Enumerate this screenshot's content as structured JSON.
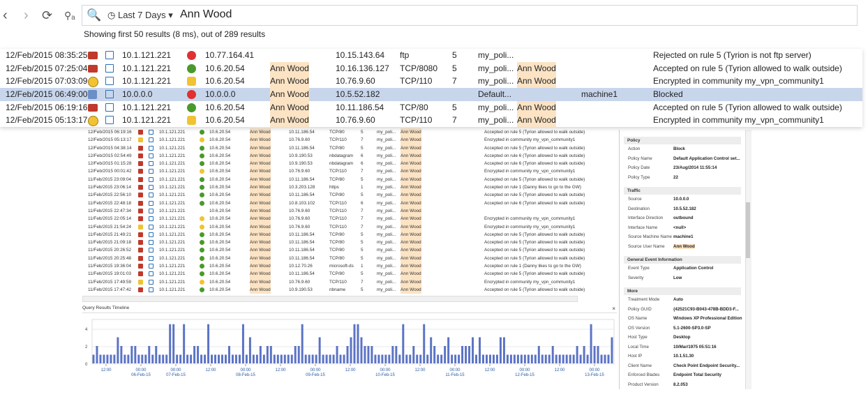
{
  "toolbar": {
    "back_icon": "‹",
    "forward_icon": "›",
    "refresh_icon": "⟳",
    "query_icon": "⚲ₐ",
    "search_icon": "🔍",
    "time_icon": "◷",
    "time_range": "Last 7 Days ▾",
    "query": "Ann Wood"
  },
  "summary": "Showing first 50 results (8 ms), out of 289 results",
  "big_rows": [
    {
      "time": "12/Feb/2015 08:35:25",
      "blade": "fw",
      "src": "10.1.121.221",
      "action": "block",
      "dst_ip": "10.77.164.41",
      "user": "",
      "dst": "10.15.143.64",
      "service": "ftp",
      "n": "5",
      "rule": "my_poli...",
      "user2": "",
      "machine": "",
      "desc": "Rejected on rule 5 (Tyrion is not ftp server)",
      "sel": false
    },
    {
      "time": "12/Feb/2015 07:25:04",
      "blade": "fw",
      "src": "10.1.121.221",
      "action": "accept",
      "dst_ip": "10.6.20.54",
      "user": "Ann Wood",
      "dst": "10.16.136.127",
      "service": "TCP/8080",
      "n": "5",
      "rule": "my_poli...",
      "user2": "Ann Wood",
      "machine": "",
      "desc": "Accepted on rule 5 (Tyrion allowed to walk outside)",
      "sel": false
    },
    {
      "time": "12/Feb/2015 07:03:09",
      "blade": "vpn",
      "src": "10.1.121.221",
      "action": "lock",
      "dst_ip": "10.6.20.54",
      "user": "Ann Wood",
      "dst": "10.76.9.60",
      "service": "TCP/110",
      "n": "7",
      "rule": "my_poli...",
      "user2": "Ann Wood",
      "machine": "",
      "desc": "Encrypted in community my_vpn_community1",
      "sel": false
    },
    {
      "time": "12/Feb/2015 06:49:00",
      "blade": "app",
      "src": "10.0.0.0",
      "action": "block",
      "dst_ip": "10.0.0.0",
      "user": "Ann Wood",
      "dst": "10.5.52.182",
      "service": "",
      "n": "",
      "rule": "Default...",
      "user2": "",
      "machine": "machine1",
      "desc": "Blocked",
      "sel": true
    },
    {
      "time": "12/Feb/2015 06:19:16",
      "blade": "fw",
      "src": "10.1.121.221",
      "action": "accept",
      "dst_ip": "10.6.20.54",
      "user": "Ann Wood",
      "dst": "10.11.186.54",
      "service": "TCP/80",
      "n": "5",
      "rule": "my_poli...",
      "user2": "Ann Wood",
      "machine": "",
      "desc": "Accepted on rule 5 (Tyrion allowed to walk outside)",
      "sel": false
    },
    {
      "time": "12/Feb/2015 05:13:17",
      "blade": "vpn",
      "src": "10.1.121.221",
      "action": "lock",
      "dst_ip": "10.6.20.54",
      "user": "Ann Wood",
      "dst": "10.76.9.60",
      "service": "TCP/110",
      "n": "7",
      "rule": "my_poli...",
      "user2": "Ann Wood",
      "machine": "",
      "desc": "Encrypted in community my_vpn_community1",
      "sel": false
    }
  ],
  "small_rows": [
    {
      "time": "12/Feb/2015 06:19:16",
      "blade": "fw",
      "src": "10.1.121.221",
      "action": "accept",
      "dst_ip": "10.6.20.54",
      "user": "Ann Wood",
      "dst": "10.11.186.54",
      "service": "TCP/80",
      "n": "5",
      "rule": "my_poli...",
      "user2": "Ann Wood",
      "desc": "Accepted on rule 5 (Tyrion allowed to walk outside)"
    },
    {
      "time": "12/Feb/2015 05:13:17",
      "blade": "vpn",
      "src": "10.1.121.221",
      "action": "lock",
      "dst_ip": "10.6.20.54",
      "user": "Ann Wood",
      "dst": "10.76.9.60",
      "service": "TCP/110",
      "n": "7",
      "rule": "my_poli...",
      "user2": "Ann Wood",
      "desc": "Encrypted in community my_vpn_community1"
    },
    {
      "time": "12/Feb/2015 04:38:14",
      "blade": "fw",
      "src": "10.1.121.221",
      "action": "accept",
      "dst_ip": "10.6.20.54",
      "user": "Ann Wood",
      "dst": "10.11.186.54",
      "service": "TCP/80",
      "n": "5",
      "rule": "my_poli...",
      "user2": "Ann Wood",
      "desc": "Accepted on rule 5 (Tyrion allowed to walk outside)"
    },
    {
      "time": "12/Feb/2015 02:54:49",
      "blade": "fw",
      "src": "10.1.121.221",
      "action": "accept",
      "dst_ip": "10.6.20.54",
      "user": "Ann Wood",
      "dst": "10.9.190.53",
      "service": "nbdatagram",
      "n": "6",
      "rule": "my_poli...",
      "user2": "Ann Wood",
      "desc": "Accepted on rule 6 (Tyrion allowed to walk outside)"
    },
    {
      "time": "12/Feb/2015 01:15:28",
      "blade": "fw",
      "src": "10.1.121.221",
      "action": "accept",
      "dst_ip": "10.6.20.54",
      "user": "Ann Wood",
      "dst": "10.9.190.53",
      "service": "nbdatagram",
      "n": "6",
      "rule": "my_poli...",
      "user2": "Ann Wood",
      "desc": "Accepted on rule 6 (Tyrion allowed to walk outside)"
    },
    {
      "time": "12/Feb/2015 00:01:42",
      "blade": "fw",
      "src": "10.1.121.221",
      "action": "lock",
      "dst_ip": "10.6.20.54",
      "user": "Ann Wood",
      "dst": "10.76.9.60",
      "service": "TCP/110",
      "n": "7",
      "rule": "my_poli...",
      "user2": "Ann Wood",
      "desc": "Encrypted in community my_vpn_community1"
    },
    {
      "time": "11/Feb/2015 23:09:04",
      "blade": "fw",
      "src": "10.1.121.221",
      "action": "accept",
      "dst_ip": "10.6.20.54",
      "user": "Ann Wood",
      "dst": "10.11.186.54",
      "service": "TCP/80",
      "n": "5",
      "rule": "my_poli...",
      "user2": "Ann Wood",
      "desc": "Accepted on rule 5 (Tyrion allowed to walk outside)"
    },
    {
      "time": "11/Feb/2015 23:06:14",
      "blade": "fw",
      "src": "10.1.121.221",
      "action": "accept",
      "dst_ip": "10.6.20.54",
      "user": "Ann Wood",
      "dst": "10.3.203.128",
      "service": "https",
      "n": "1",
      "rule": "my_poli...",
      "user2": "Ann Wood",
      "desc": "Accepted on rule 1 (Danny likes to go to the GW)"
    },
    {
      "time": "11/Feb/2015 22:56:10",
      "blade": "fw",
      "src": "10.1.121.221",
      "action": "accept",
      "dst_ip": "10.6.20.54",
      "user": "Ann Wood",
      "dst": "10.11.186.54",
      "service": "TCP/80",
      "n": "5",
      "rule": "my_poli...",
      "user2": "Ann Wood",
      "desc": "Accepted on rule 5 (Tyrion allowed to walk outside)"
    },
    {
      "time": "11/Feb/2015 22:48:18",
      "blade": "fw",
      "src": "10.1.121.221",
      "action": "accept",
      "dst_ip": "10.6.20.54",
      "user": "Ann Wood",
      "dst": "10.8.103.102",
      "service": "TCP/110",
      "n": "6",
      "rule": "my_poli...",
      "user2": "Ann Wood",
      "desc": "Accepted on rule 6 (Tyrion allowed to walk outside)"
    },
    {
      "time": "11/Feb/2015 22:47:34",
      "blade": "fw",
      "src": "10.1.121.221",
      "action": "",
      "dst_ip": "10.6.20.54",
      "user": "Ann Wood",
      "dst": "10.76.9.60",
      "service": "TCP/110",
      "n": "7",
      "rule": "my_poli...",
      "user2": "Ann Wood",
      "desc": ""
    },
    {
      "time": "11/Feb/2015 22:05:14",
      "blade": "fw",
      "src": "10.1.121.221",
      "action": "lock",
      "dst_ip": "10.6.20.54",
      "user": "Ann Wood",
      "dst": "10.76.9.60",
      "service": "TCP/110",
      "n": "7",
      "rule": "my_poli...",
      "user2": "Ann Wood",
      "desc": "Encrypted in community my_vpn_community1"
    },
    {
      "time": "11/Feb/2015 21:54:24",
      "blade": "vpn",
      "src": "10.1.121.221",
      "action": "lock",
      "dst_ip": "10.6.20.54",
      "user": "Ann Wood",
      "dst": "10.76.9.60",
      "service": "TCP/110",
      "n": "7",
      "rule": "my_poli...",
      "user2": "Ann Wood",
      "desc": "Encrypted in community my_vpn_community1"
    },
    {
      "time": "11/Feb/2015 21:49:21",
      "blade": "fw",
      "src": "10.1.121.221",
      "action": "accept",
      "dst_ip": "10.6.20.54",
      "user": "Ann Wood",
      "dst": "10.11.186.54",
      "service": "TCP/80",
      "n": "5",
      "rule": "my_poli...",
      "user2": "Ann Wood",
      "desc": "Accepted on rule 5 (Tyrion allowed to walk outside)"
    },
    {
      "time": "11/Feb/2015 21:09:18",
      "blade": "fw",
      "src": "10.1.121.221",
      "action": "accept",
      "dst_ip": "10.6.20.54",
      "user": "Ann Wood",
      "dst": "10.11.186.54",
      "service": "TCP/80",
      "n": "5",
      "rule": "my_poli...",
      "user2": "Ann Wood",
      "desc": "Accepted on rule 5 (Tyrion allowed to walk outside)"
    },
    {
      "time": "11/Feb/2015 20:26:52",
      "blade": "fw",
      "src": "10.1.121.221",
      "action": "accept",
      "dst_ip": "10.6.20.54",
      "user": "Ann Wood",
      "dst": "10.11.186.54",
      "service": "TCP/80",
      "n": "5",
      "rule": "my_poli...",
      "user2": "Ann Wood",
      "desc": "Accepted on rule 5 (Tyrion allowed to walk outside)"
    },
    {
      "time": "11/Feb/2015 20:25:48",
      "blade": "fw",
      "src": "10.1.121.221",
      "action": "accept",
      "dst_ip": "10.6.20.54",
      "user": "Ann Wood",
      "dst": "10.11.186.54",
      "service": "TCP/80",
      "n": "5",
      "rule": "my_poli...",
      "user2": "Ann Wood",
      "desc": "Accepted on rule 5 (Tyrion allowed to walk outside)"
    },
    {
      "time": "11/Feb/2015 19:36:04",
      "blade": "fw",
      "src": "10.1.121.221",
      "action": "accept",
      "dst_ip": "10.6.20.54",
      "user": "Ann Wood",
      "dst": "10.12.70.26",
      "service": "microsoft-ds",
      "n": "1",
      "rule": "my_poli...",
      "user2": "Ann Wood",
      "desc": "Accepted on rule 1 (Danny likes to go to the GW)"
    },
    {
      "time": "11/Feb/2015 19:01:03",
      "blade": "fw",
      "src": "10.1.121.221",
      "action": "accept",
      "dst_ip": "10.6.20.54",
      "user": "Ann Wood",
      "dst": "10.11.186.54",
      "service": "TCP/80",
      "n": "5",
      "rule": "my_poli...",
      "user2": "Ann Wood",
      "desc": "Accepted on rule 5 (Tyrion allowed to walk outside)"
    },
    {
      "time": "11/Feb/2015 17:49:59",
      "blade": "vpn",
      "src": "10.1.121.221",
      "action": "lock",
      "dst_ip": "10.6.20.54",
      "user": "Ann Wood",
      "dst": "10.76.9.60",
      "service": "TCP/110",
      "n": "7",
      "rule": "my_poli...",
      "user2": "Ann Wood",
      "desc": "Encrypted in community my_vpn_community1"
    },
    {
      "time": "11/Feb/2015 17:47:42",
      "blade": "fw",
      "src": "10.1.121.221",
      "action": "accept",
      "dst_ip": "10.6.20.54",
      "user": "Ann Wood",
      "dst": "10.9.190.53",
      "service": "nbname",
      "n": "5",
      "rule": "my_poli...",
      "user2": "Ann Wood",
      "desc": "Accepted on rule 5 (Tyrion allowed to walk outside)"
    }
  ],
  "timeline": {
    "title": "Query Results Timeline",
    "close": "×",
    "y_ticks": [
      "4",
      "2",
      "0"
    ],
    "x_labels": [
      [
        "12:00",
        ""
      ],
      [
        "00:00",
        "06-Feb-15"
      ],
      [
        "00:00",
        "07-Feb-15"
      ],
      [
        "12:00",
        ""
      ],
      [
        "00:00",
        "08-Feb-15"
      ],
      [
        "12:00",
        ""
      ],
      [
        "00:00",
        "09-Feb-15"
      ],
      [
        "12:00",
        ""
      ],
      [
        "00:00",
        "10-Feb-15"
      ],
      [
        "12:00",
        ""
      ],
      [
        "00:00",
        "11-Feb-15"
      ],
      [
        "12:00",
        ""
      ],
      [
        "00:00",
        "12-Feb-15"
      ],
      [
        "12:00",
        ""
      ],
      [
        "00:00",
        "13-Feb-15"
      ],
      [
        "12:00",
        ""
      ]
    ],
    "bar_color": "#5b73c4"
  },
  "details": {
    "sections": [
      {
        "title": "Policy",
        "rows": [
          [
            "Action",
            "Block"
          ],
          [
            "Policy Name",
            "Default Application Control set..."
          ],
          [
            "Policy Date",
            "23/Aug/2014 11:55:14"
          ],
          [
            "Policy Type",
            "22"
          ]
        ]
      },
      {
        "title": "Traffic",
        "rows": [
          [
            "Source",
            "10.0.0.0"
          ],
          [
            "Destination",
            "10.5.52.182"
          ],
          [
            "Interface Direction",
            "outbound"
          ],
          [
            "Interface Name",
            "<null>"
          ],
          [
            "Source Machine Name",
            "machine1"
          ],
          [
            "Source User Name",
            "Ann Wood"
          ]
        ]
      },
      {
        "title": "General Event Information",
        "rows": [
          [
            "Event Type",
            "Application Control"
          ],
          [
            "Severity",
            "Low"
          ]
        ]
      },
      {
        "title": "More",
        "rows": [
          [
            "Treatment Mode",
            "Auto"
          ],
          [
            "Policy GUID",
            "{42521C93-B043-478B-BDD3-F..."
          ],
          [
            "OS Name",
            "Windows XP Professional Edition"
          ],
          [
            "OS Version",
            "5.1-2600-SP3.0-SP"
          ],
          [
            "Host Type",
            "Desktop"
          ],
          [
            "Local Time",
            "10/Mar/1975 05:51:16"
          ],
          [
            "Host IP",
            "10.1.51.30"
          ],
          [
            "Client Name",
            "Check Point Endpoint Security..."
          ],
          [
            "Enforced Blades",
            "Endpoint Total Security"
          ],
          [
            "Product Version",
            "8.2.053"
          ]
        ]
      }
    ]
  }
}
